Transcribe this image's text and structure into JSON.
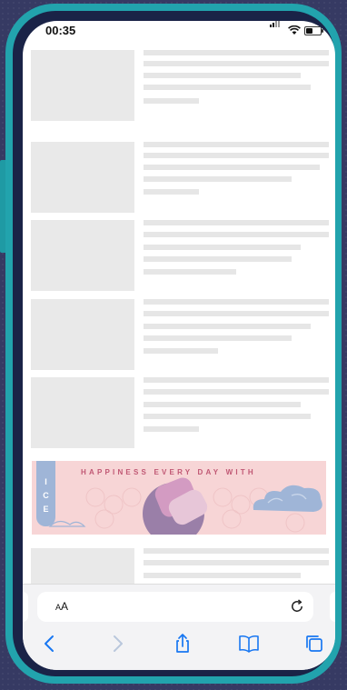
{
  "status_bar": {
    "time": "00:35"
  },
  "ad": {
    "headline": "HAPPINESS EVERY DAY WITH",
    "tab_letters": [
      "I",
      "C",
      "E"
    ]
  },
  "address_bar": {
    "text_size_small": "A",
    "text_size_large": "A"
  },
  "toolbar": {
    "icons": [
      "back-icon",
      "forward-icon",
      "share-icon",
      "bookmarks-icon",
      "tabs-icon"
    ]
  },
  "colors": {
    "phone_frame": "#22a3ad",
    "skeleton": "#e6e6e6",
    "ad_background": "#f7d5d6",
    "accent_blue": "#1877f2"
  }
}
